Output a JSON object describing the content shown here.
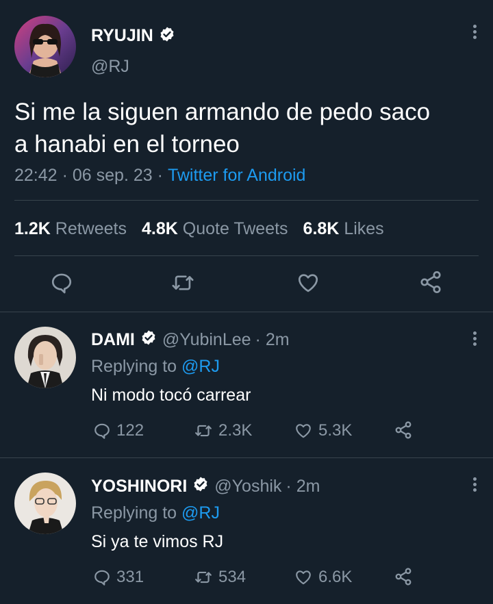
{
  "main_tweet": {
    "author_name": "RYUJIN",
    "author_handle": "@RJ",
    "text_line1": "Si me la siguen armando de pedo saco",
    "text_line2": "a hanabi en el torneo",
    "time": "22:42",
    "date": "06 sep. 23",
    "separator": "·",
    "source": "Twitter for Android",
    "stats": {
      "retweets_count": "1.2K",
      "retweets_label": "Retweets",
      "quotes_count": "4.8K",
      "quotes_label": "Quote Tweets",
      "likes_count": "6.8K",
      "likes_label": "Likes"
    }
  },
  "replies": [
    {
      "author_name": "DAMI",
      "handle": "@YubinLee",
      "time": "· 2m",
      "replying_prefix": "Replying to",
      "replying_to": "@RJ",
      "text": "Ni modo tocó carrear",
      "replies": "122",
      "retweets": "2.3K",
      "likes": "5.3K"
    },
    {
      "author_name": "YOSHINORI",
      "handle": "@Yoshik",
      "time": "· 2m",
      "replying_prefix": "Replying to",
      "replying_to": "@RJ",
      "text": "Si ya te vimos RJ",
      "replies": "331",
      "retweets": "534",
      "likes": "6.6K"
    }
  ],
  "colors": {
    "background": "#15202b",
    "text": "#ffffff",
    "muted": "#8b98a5",
    "accent": "#1d9bf0",
    "divider": "#38444d"
  },
  "icons": {
    "reply": "speech-bubble-icon",
    "retweet": "retweet-icon",
    "like": "heart-icon",
    "share": "share-icon",
    "more": "kebab-menu-icon",
    "verified": "verified-badge-icon"
  }
}
